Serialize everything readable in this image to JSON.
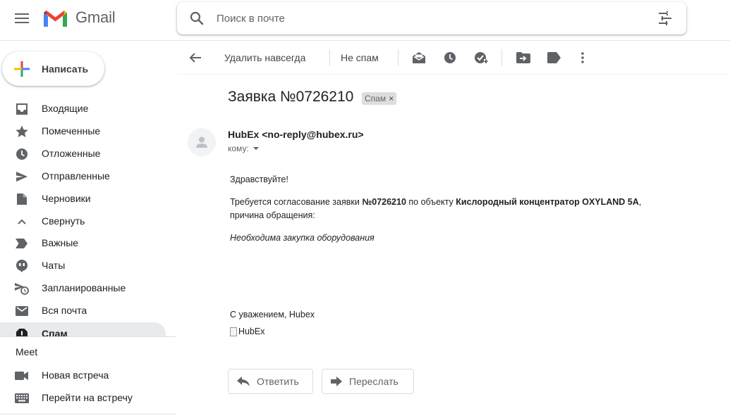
{
  "header": {
    "app_name": "Gmail",
    "search_placeholder": "Поиск в почте"
  },
  "sidebar": {
    "compose_label": "Написать",
    "items": [
      {
        "label": "Входящие",
        "icon": "inbox-icon"
      },
      {
        "label": "Помеченные",
        "icon": "star-icon"
      },
      {
        "label": "Отложенные",
        "icon": "clock-icon"
      },
      {
        "label": "Отправленные",
        "icon": "send-icon"
      },
      {
        "label": "Черновики",
        "icon": "draft-icon"
      },
      {
        "label": "Свернуть",
        "icon": "chevron-up-icon"
      },
      {
        "label": "Важные",
        "icon": "label-important-icon"
      },
      {
        "label": "Чаты",
        "icon": "chat-icon"
      },
      {
        "label": "Запланированные",
        "icon": "scheduled-send-icon"
      },
      {
        "label": "Вся почта",
        "icon": "mail-icon"
      },
      {
        "label": "Спам",
        "icon": "spam-icon",
        "active": true
      }
    ],
    "meet": {
      "title": "Meet",
      "new_meeting": "Новая встреча",
      "join_meeting": "Перейти на встречу"
    }
  },
  "toolbar": {
    "delete_forever": "Удалить навсегда",
    "not_spam": "Не спам"
  },
  "message": {
    "subject": "Заявка №0726210",
    "badge": "Спам",
    "badge_close": "×",
    "sender": "HubEx <no-reply@hubex.ru>",
    "to": "кому:",
    "greeting": "Здравствуйте!",
    "line1_pre": "Требуется согласование заявки ",
    "line1_num": "№0726210",
    "line1_mid": " по объекту ",
    "line1_obj": "Кислородный концентратор OXYLAND 5A",
    "line1_end": ",",
    "line2": "причина обращения:",
    "reason": "Необходима закупка оборудования",
    "signoff": "С уважением, Hubex",
    "image_alt": "HubEx"
  },
  "actions": {
    "reply": "Ответить",
    "forward": "Переслать"
  },
  "colors": {
    "gmail_red": "#EA4335",
    "gmail_blue": "#4285F4",
    "gmail_green": "#34A853",
    "gmail_yellow": "#FBBC04",
    "icon_gray": "#5f6368",
    "active_bg": "#e8eaed"
  }
}
